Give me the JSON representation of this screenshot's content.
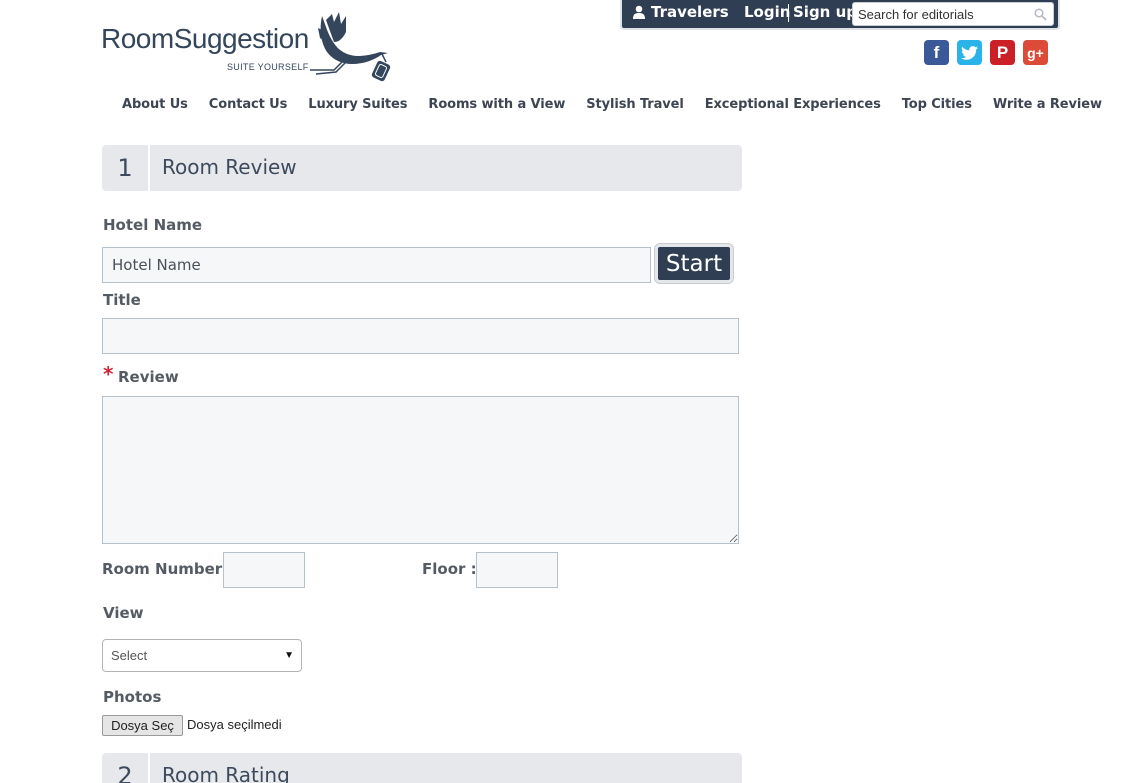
{
  "topbar": {
    "travelers_label": "Travelers",
    "login_label": "Login",
    "signup_label": "Sign up",
    "search_placeholder": "Search for editorials"
  },
  "social": {
    "facebook_glyph": "f",
    "twitter_icon": "twitter-icon",
    "pinterest_glyph": "P",
    "googleplus_glyph": "g+"
  },
  "logo": {
    "name": "RoomSuggestion",
    "tagline": "SUITE YOURSELF"
  },
  "nav": {
    "items": [
      "About Us",
      "Contact Us",
      "Luxury Suites",
      "Rooms with a View",
      "Stylish Travel",
      "Exceptional Experiences",
      "Top Cities",
      "Write a Review"
    ]
  },
  "section1": {
    "number": "1",
    "title": "Room Review"
  },
  "form": {
    "hotel_name_label": "Hotel Name",
    "hotel_name_value": "Hotel Name",
    "start_label": "Start",
    "title_label": "Title",
    "title_value": "",
    "required_marker": "*",
    "review_label": "Review",
    "review_value": "",
    "room_number_label": "Room Number :",
    "floor_label": "Floor :",
    "view_label": "View",
    "view_selected": "Select",
    "photos_label": "Photos",
    "file_button_label": "Dosya Seç",
    "file_status": "Dosya seçilmedi"
  },
  "section2": {
    "number": "2",
    "title": "Room Rating"
  },
  "colors": {
    "topbar_bg": "#2f3e52",
    "section_bg": "#e6e8ec",
    "required": "#d0263c",
    "facebook": "#3b5998",
    "twitter": "#29b3e8",
    "pinterest": "#cb2027",
    "googleplus": "#dc4a38"
  }
}
